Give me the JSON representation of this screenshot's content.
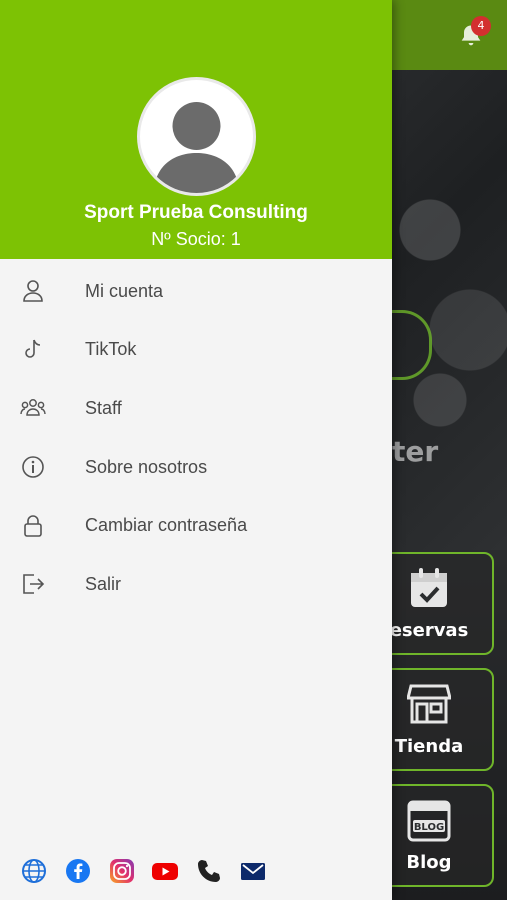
{
  "header": {
    "notification_count": "4",
    "hero_text": "ter"
  },
  "tiles": [
    {
      "label": "eservas",
      "icon": "calendar-check-icon"
    },
    {
      "label": "Tienda",
      "icon": "store-icon"
    },
    {
      "label": "Blog",
      "icon": "blog-icon"
    }
  ],
  "drawer": {
    "profile": {
      "name": "Sport Prueba Consulting",
      "member_number": "Nº Socio: 1"
    },
    "menu": [
      {
        "label": "Mi cuenta",
        "icon": "user-icon"
      },
      {
        "label": "TikTok",
        "icon": "tiktok-icon"
      },
      {
        "label": "Staff",
        "icon": "group-icon"
      },
      {
        "label": "Sobre nosotros",
        "icon": "info-icon"
      },
      {
        "label": "Cambiar contraseña",
        "icon": "lock-icon"
      },
      {
        "label": "Salir",
        "icon": "logout-icon"
      }
    ],
    "social": [
      "globe-icon",
      "facebook-icon",
      "instagram-icon",
      "youtube-icon",
      "phone-icon",
      "email-icon"
    ]
  },
  "colors": {
    "drawer_header": "#7dc204",
    "tile_border": "#6fb52a",
    "badge": "#d32f2f"
  }
}
